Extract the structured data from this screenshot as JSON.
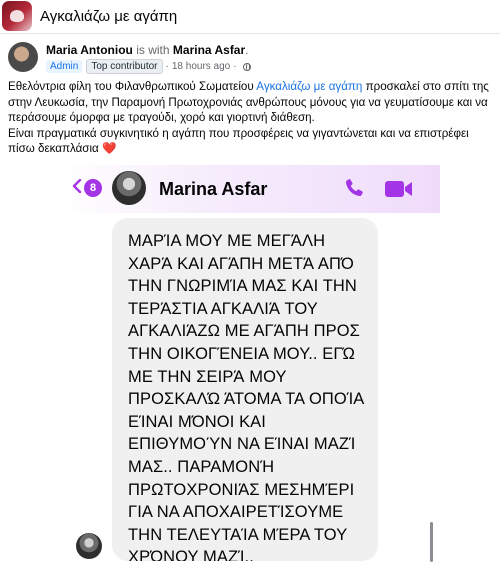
{
  "group": {
    "name": "Αγκαλιάζω με αγάπη"
  },
  "post": {
    "author": "Maria Antoniou",
    "is_with": " is with ",
    "tagged": "Marina Asfar",
    "tagged_suffix": ".",
    "badges": [
      "Admin",
      "Top contributor"
    ],
    "separator": "·",
    "timestamp": "18 hours ago",
    "text_part1": "Εθελόντρια φίλη του Φιλανθρωπικού Σωματείου ",
    "text_link": "Αγκαλιάζω με αγάπη",
    "text_part2": " προσκαλεί στο σπίτι της στην Λευκωσία, την Παραμονή Πρωτοχρονιάς ανθρώπους μόνους για να γευματίσουμε και να περάσουμε όμορφα με τραγούδι, χορό και γιορτινή διάθεση.",
    "text_para2": "Είναι πραγματικά συγκινητικό η αγάπη που προσφέρεις να γιγαντώνεται και να επιστρέφει πίσω δεκαπλάσια ",
    "heart": "❤️"
  },
  "chat": {
    "unread_count": "8",
    "contact_name": "Marina Asfar",
    "message": "ΜΑΡΊΑ ΜΟΥ ΜΕ ΜΕΓΆΛΗ\nΧΑΡΆ ΚΑΙ ΑΓΆΠΗ ΜΕΤΆ ΑΠΌ\nΤΗΝ ΓΝΩΡΙΜΊΑ ΜΑΣ ΚΑΙ ΤΗΝ\nΤΕΡΆΣΤΙΑ ΑΓΚΑΛΙΆ ΤΟΥ\nΑΓΚΑΛΙΆΖΩ ΜΕ ΑΓΆΠΗ ΠΡΟΣ\nΤΗΝ ΟΙΚΟΓΈΝΕΙΑ ΜΟΥ.. ΕΓΏ\nΜΕ ΤΗΝ ΣΕΙΡΆ ΜΟΥ\nΠΡΟΣΚΑΛΏ ΆΤΟΜΑ ΤΑ ΟΠΟΊΑ\nΕΊΝΑΙ ΜΌΝΟΙ ΚΑΙ\nΕΠΙΘΥΜΟΎΝ ΝΑ ΕΊΝΑΙ ΜΑΖΊ\nΜΑΣ.. ΠΑΡΑΜΟΝΉ\nΠΡΩΤΟΧΡΟΝΙΆΣ ΜΕΣΗΜΈΡΙ\nΓΙΑ ΝΑ ΑΠΟΧΑΙΡΕΤΊΣΟΥΜΕ\nΤΗΝ ΤΕΛΕΥΤΑΊΑ ΜΈΡΑ ΤΟΥ\nΧΡΌΝΟΥ ΜΑΖΊ..",
    "accent_color": "#a335e6"
  },
  "colors": {
    "link": "#1b74e4",
    "muted": "#65676b",
    "bubble": "#f0f0f0"
  },
  "icons": [
    "globe-icon",
    "heart-icon",
    "back-chevron-icon",
    "phone-icon",
    "video-camera-icon"
  ]
}
